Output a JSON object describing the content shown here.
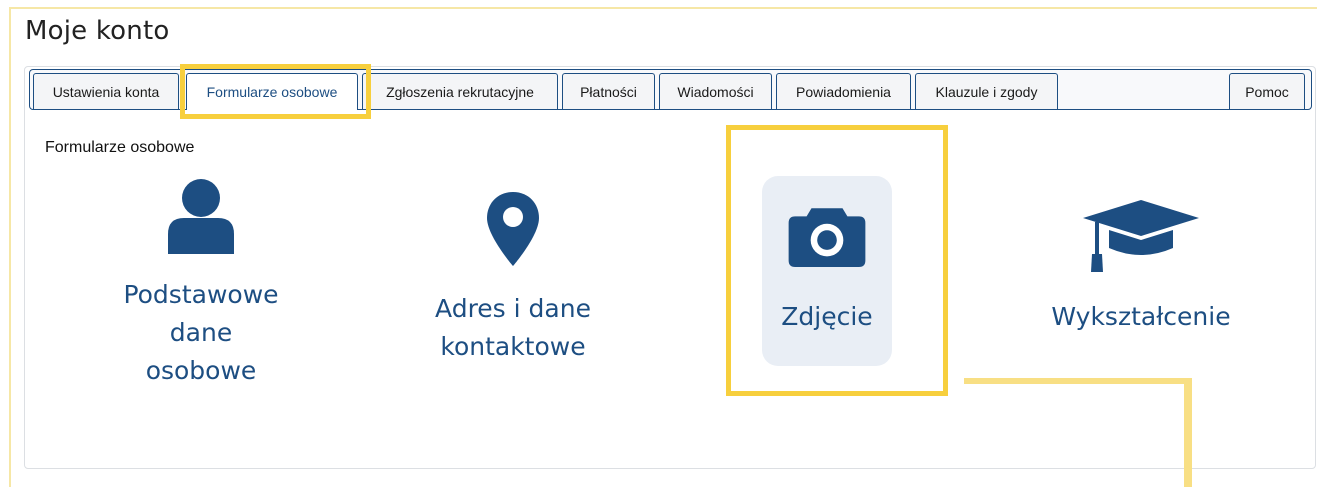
{
  "page": {
    "title": "Moje konto"
  },
  "tabs": [
    {
      "label": "Ustawienia konta",
      "active": false
    },
    {
      "label": "Formularze osobowe",
      "active": true
    },
    {
      "label": "Zgłoszenia rekrutacyjne",
      "active": false
    },
    {
      "label": "Płatności",
      "active": false
    },
    {
      "label": "Wiadomości",
      "active": false
    },
    {
      "label": "Powiadomienia",
      "active": false
    },
    {
      "label": "Klauzule i zgody",
      "active": false
    },
    {
      "label": "Pomoc",
      "active": false
    }
  ],
  "section": {
    "title": "Formularze osobowe"
  },
  "tiles": [
    {
      "label": "Podstawowe dane osobowe",
      "lines": [
        "Podstawowe",
        "dane",
        "osobowe"
      ],
      "icon": "user-icon"
    },
    {
      "label": "Adres i dane kontaktowe",
      "lines": [
        "Adres i dane",
        "kontaktowe"
      ],
      "icon": "map-pin-icon"
    },
    {
      "label": "Zdjęcie",
      "lines": [
        "Zdjęcie"
      ],
      "icon": "camera-icon",
      "selected": true
    },
    {
      "label": "Wykształcenie",
      "lines": [
        "Wykształcenie"
      ],
      "icon": "graduation-cap-icon"
    }
  ],
  "colors": {
    "accent": "#1d4e82",
    "highlight": "#f7cf3d",
    "tile_selected_bg": "#e9eef5"
  }
}
